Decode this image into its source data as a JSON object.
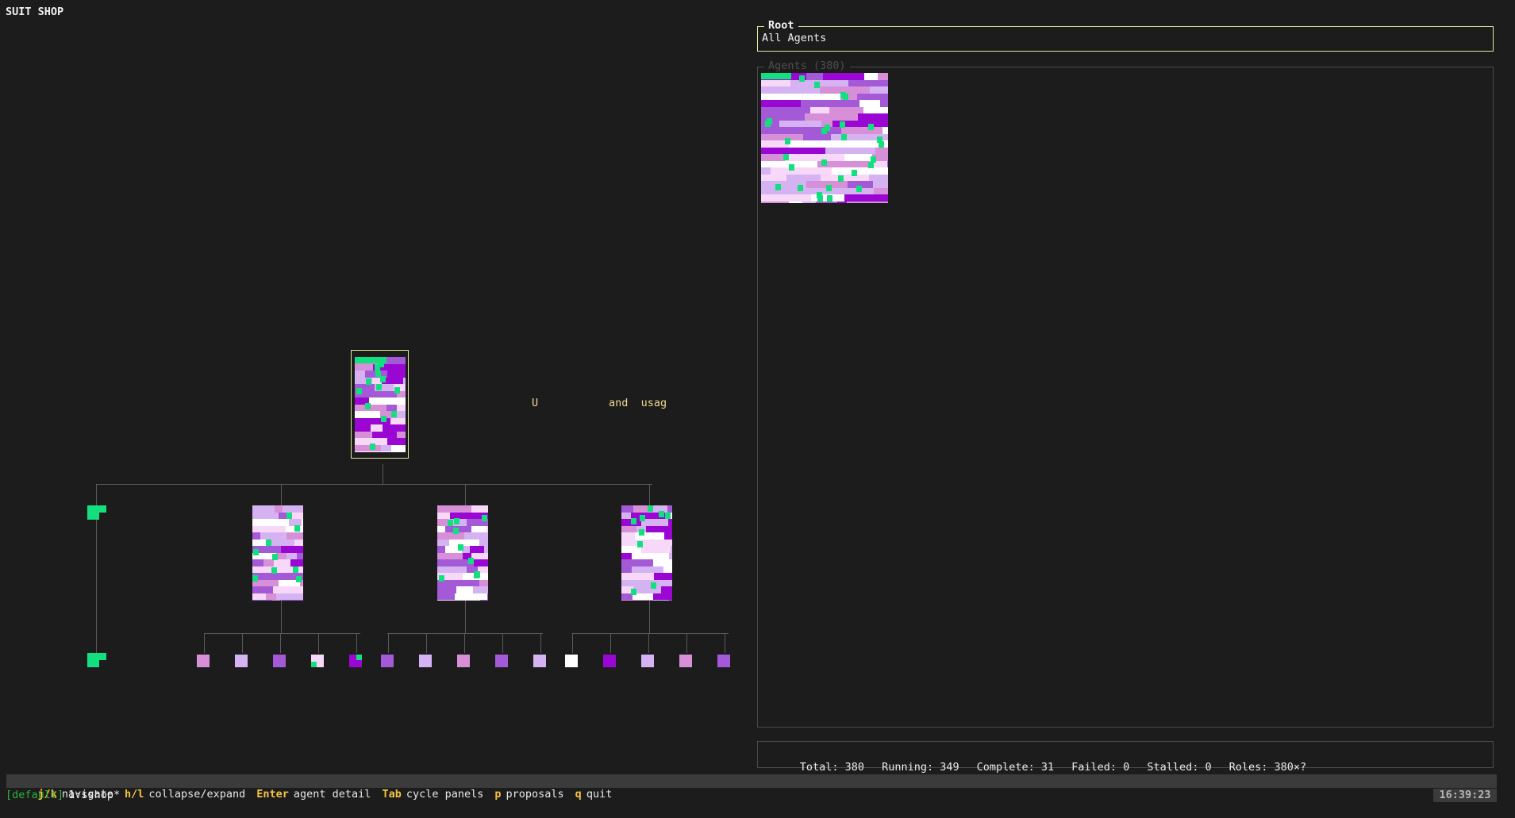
{
  "app": {
    "title": "SUIT SHOP"
  },
  "root_panel": {
    "title": "Root",
    "value": "All Agents"
  },
  "agents_panel": {
    "title": "Agents (380)"
  },
  "status": {
    "total": "Total: 380",
    "running": "Running: 349",
    "complete": "Complete: 31",
    "failed": "Failed: 0",
    "stalled": "Stalled: 0",
    "roles": "Roles: 380×?"
  },
  "floating_text": {
    "a": "U",
    "b": "and  usag"
  },
  "help": [
    {
      "key": "j/k",
      "desc": "navigate"
    },
    {
      "key": "h/l",
      "desc": "collapse/expand"
    },
    {
      "key": "Enter",
      "desc": "agent detail"
    },
    {
      "key": "Tab",
      "desc": "cycle panels"
    },
    {
      "key": "p",
      "desc": "proposals"
    },
    {
      "key": "q",
      "desc": "quit"
    }
  ],
  "tmux": {
    "session": "[default]",
    "window": "1:sshop*",
    "clock": "16:39:23"
  },
  "colors": {
    "accent_green": "#12e07f",
    "purple_light": "#d5b3f3",
    "purple_mid": "#a45ad6",
    "pink": "#d78fd8",
    "magenta_dark": "#9a07d2",
    "pink_pale": "#f8d8f8",
    "white": "#ffffff",
    "highlight_border": "#e8e6a0"
  }
}
